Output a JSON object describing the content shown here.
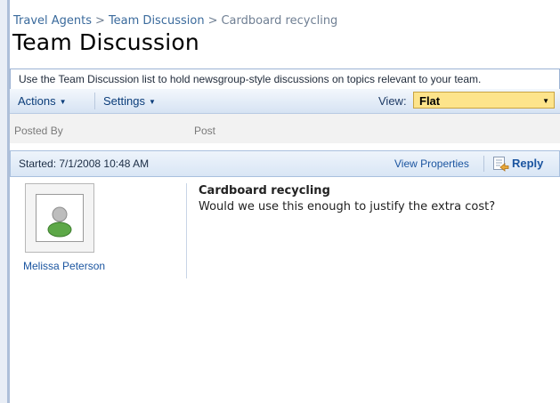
{
  "breadcrumb": {
    "items": [
      "Travel Agents",
      "Team Discussion"
    ],
    "separator": ">",
    "current": "Cardboard recycling"
  },
  "page": {
    "title": "Team Discussion",
    "description": "Use the Team Discussion list to hold newsgroup-style discussions on topics relevant to your team."
  },
  "toolbar": {
    "actions_label": "Actions",
    "settings_label": "Settings",
    "view_label": "View:",
    "view_value": "Flat"
  },
  "columns": {
    "posted_by": "Posted By",
    "post": "Post"
  },
  "thread": {
    "started": "Started: 7/1/2008 10:48 AM",
    "view_properties": "View Properties",
    "reply": "Reply"
  },
  "post": {
    "author": "Melissa Peterson",
    "subject": "Cardboard recycling",
    "body": "Would we use this enough to justify the extra cost?"
  },
  "icons": {
    "caret": "triangle-down",
    "reply": "reply-icon",
    "avatar": "person-icon"
  },
  "colors": {
    "link": "#1b55a0",
    "view_select_bg": "#fde48b",
    "toolbar_border": "#b9cbe3"
  }
}
